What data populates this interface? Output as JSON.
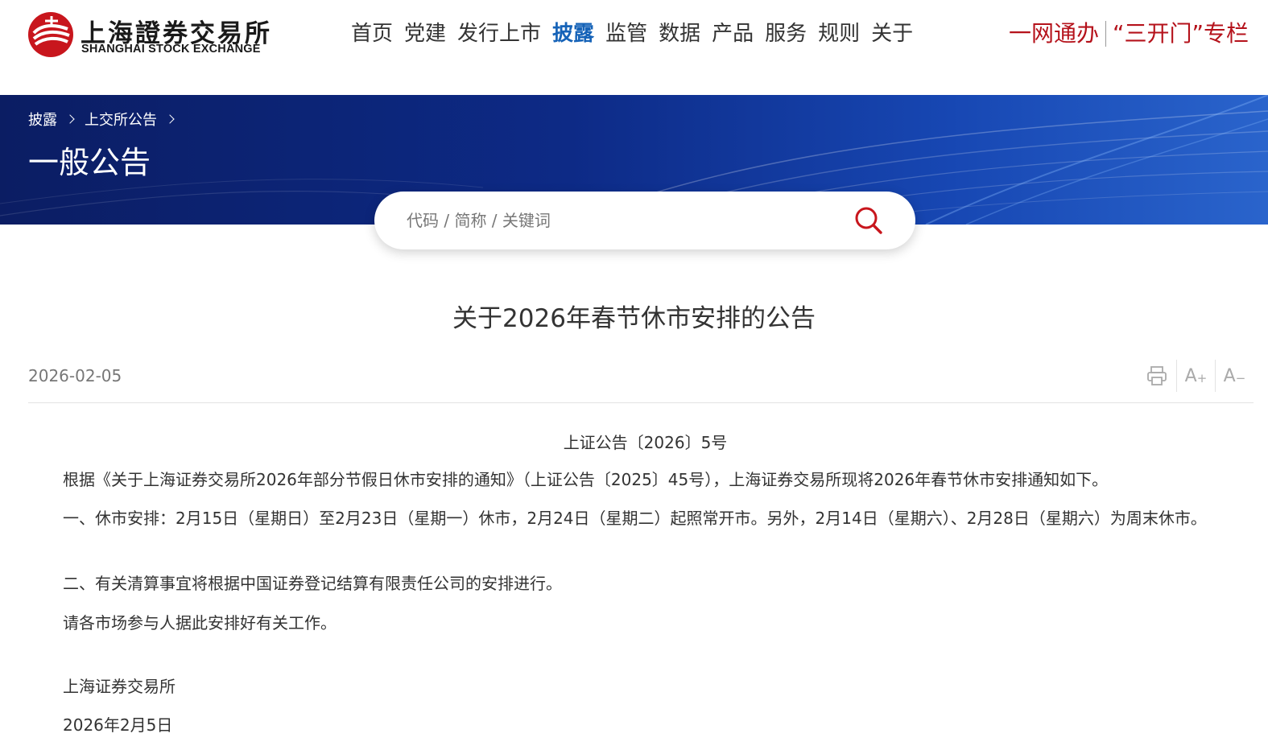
{
  "header": {
    "logo_cn": "上海證券交易所",
    "logo_en": "SHANGHAI STOCK EXCHANGE",
    "nav": [
      "首页",
      "党建",
      "发行上市",
      "披露",
      "监管",
      "数据",
      "产品",
      "服务",
      "规则",
      "关于"
    ],
    "active_nav": "披露",
    "promo_links": [
      "一网通办",
      "“三开门”专栏"
    ],
    "promo_color": "#b5121b",
    "active_color": "#1663b8"
  },
  "banner": {
    "breadcrumb": [
      "披露",
      "上交所公告"
    ],
    "title": "一般公告"
  },
  "search": {
    "placeholder": "代码 / 简称 / 关键词",
    "value": "",
    "icon": "search-icon"
  },
  "article": {
    "title": "关于2026年春节休市安排的公告",
    "date": "2026-02-05",
    "tools": {
      "print_icon": "print-icon",
      "font_increase": "A",
      "font_increase_sign": "+",
      "font_decrease": "A",
      "font_decrease_sign": "−"
    },
    "doc_number": "上证公告〔2026〕5号",
    "paragraphs": [
      "根据《关于上海证券交易所2026年部分节假日休市安排的通知》（上证公告〔2025〕45号），上海证券交易所现将2026年春节休市安排通知如下。",
      "一、休市安排：2月15日（星期日）至2月23日（星期一）休市，2月24日（星期二）起照常开市。另外，2月14日（星期六）、2月28日（星期六）为周末休市。",
      "二、有关清算事宜将根据中国证券登记结算有限责任公司的安排进行。",
      "请各市场参与人据此安排好有关工作。"
    ],
    "signature": "上海证券交易所",
    "sign_date": "2026年2月5日"
  }
}
